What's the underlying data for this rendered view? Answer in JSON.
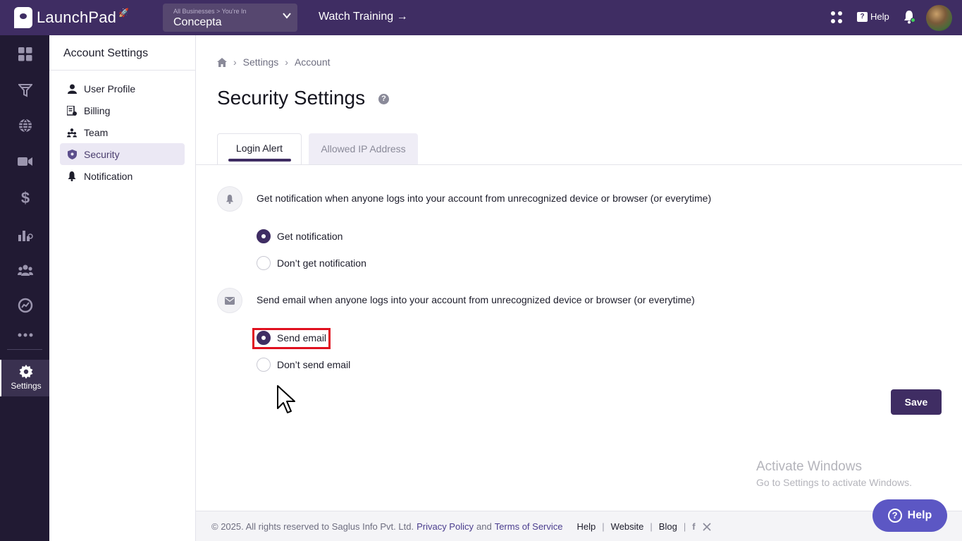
{
  "topbar": {
    "app_name": "LaunchPad",
    "business_caption": "All Businesses > You're In",
    "business_name": "Concepta",
    "watch_training": "Watch Training →",
    "help_label": "Help",
    "colors": {
      "bar": "#3f2d63",
      "accent": "#3f2d63"
    }
  },
  "rail": {
    "items": [
      "dashboard-icon",
      "funnel-icon",
      "globe-icon",
      "video-icon",
      "dollar-icon",
      "chart-icon",
      "people-icon",
      "analytics-icon",
      "more-icon"
    ],
    "active_label": "Settings"
  },
  "sidebar": {
    "title": "Account Settings",
    "items": [
      {
        "label": "User Profile",
        "icon": "user-icon"
      },
      {
        "label": "Billing",
        "icon": "billing-icon"
      },
      {
        "label": "Team",
        "icon": "team-icon"
      },
      {
        "label": "Security",
        "icon": "shield-icon",
        "active": true
      },
      {
        "label": "Notification",
        "icon": "bell-icon"
      }
    ]
  },
  "breadcrumb": {
    "home": "home-icon",
    "items": [
      "Settings",
      "Account"
    ]
  },
  "page": {
    "title": "Security Settings",
    "tabs": [
      {
        "label": "Login Alert",
        "active": true
      },
      {
        "label": "Allowed IP Address",
        "active": false
      }
    ],
    "sections": [
      {
        "text": "Get notification when anyone logs into your account from unrecognized device or browser (or everytime)",
        "options": [
          {
            "label": "Get notification",
            "selected": true
          },
          {
            "label": "Don’t get notification",
            "selected": false
          }
        ]
      },
      {
        "text": "Send email when anyone logs into your account from unrecognized device or browser (or everytime)",
        "options": [
          {
            "label": "Send email",
            "selected": true
          },
          {
            "label": "Don’t send email",
            "selected": false
          }
        ]
      }
    ],
    "save_label": "Save"
  },
  "watermark": {
    "line1": "Activate Windows",
    "line2": "Go to Settings to activate Windows."
  },
  "footer": {
    "copyright": "©  2025. All rights reserved to Saglus Info Pvt. Ltd.",
    "privacy": "Privacy Policy",
    "and": "and",
    "terms": "Terms of Service",
    "help": "Help",
    "website": "Website",
    "blog": "Blog"
  },
  "help_button": {
    "label": "Help"
  }
}
